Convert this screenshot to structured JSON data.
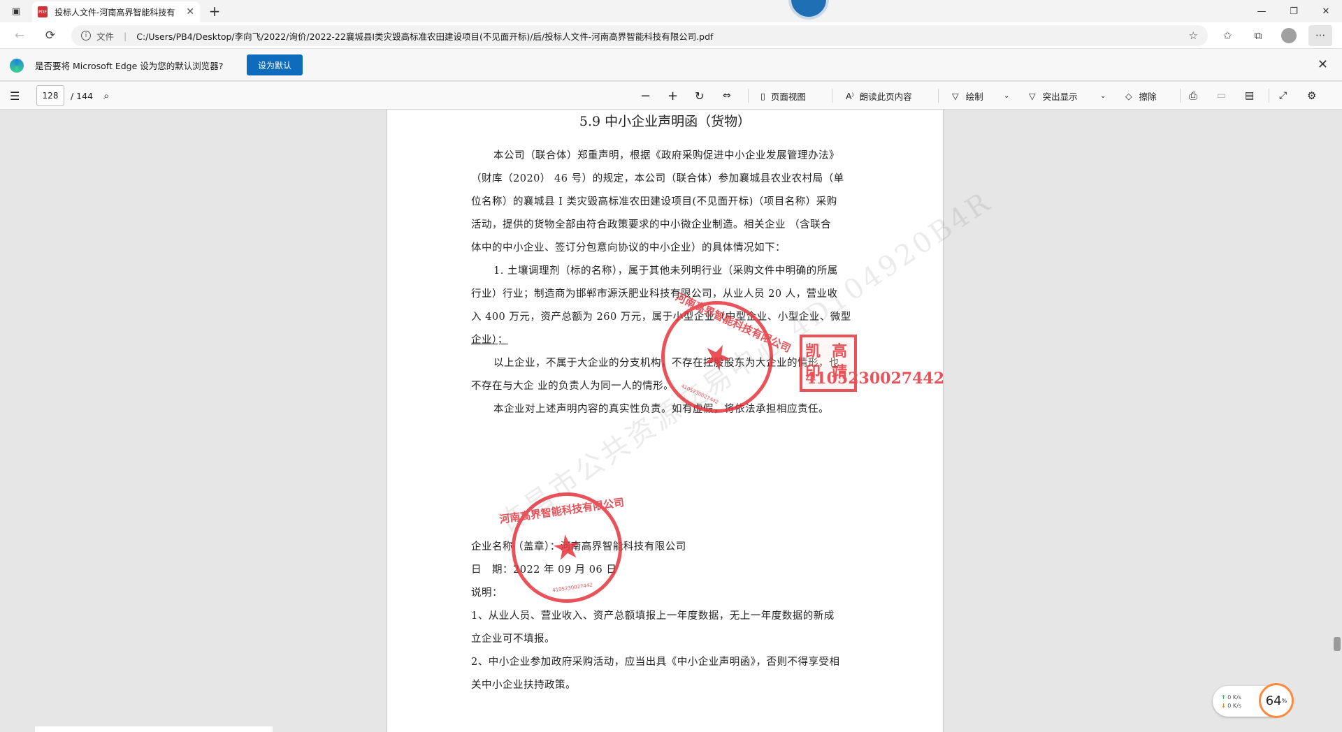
{
  "browser": {
    "tab_title": "投标人文件-河南高界智能科技有",
    "tab_icon": "pdf-icon",
    "new_tab": "+",
    "window_controls": {
      "minimize": "—",
      "restore": "❐",
      "close": "✕"
    },
    "address": {
      "label": "文件",
      "url": "C:/Users/PB4/Desktop/李向飞/2022/询价/2022-22襄城县Ⅰ类灾毁高标准农田建设项目(不见面开标)/后/投标人文件-河南高界智能科技有限公司.pdf"
    }
  },
  "infobar": {
    "message": "是否要将 Microsoft Edge 设为您的默认浏览器?",
    "button": "设为默认"
  },
  "pdf_toolbar": {
    "page_current": "128",
    "page_total": "/ 144",
    "page_view": "页面视图",
    "read_aloud": "朗读此页内容",
    "draw": "绘制",
    "highlight": "突出显示",
    "erase": "擦除"
  },
  "document": {
    "heading": "5.9 中小企业声明函（货物）",
    "lines": [
      "本公司（联合体）郑重声明，根据《政府采购促进中小企业发展管理办法》",
      "（财库（2020） 46 号）的规定，本公司（联合体）参加襄城县农业农村局（单",
      "位名称）的襄城县 I 类灾毁高标准农田建设项目(不见面开标)（项目名称）采购",
      "活动，提供的货物全部由符合政策要求的中小微企业制造。相关企业 （含联合",
      "体中的中小企业、签订分包意向协议的中小企业）的具体情况如下：",
      "1. 土壤调理剂（标的名称），属于其他未列明行业（采购文件中明确的所属",
      "行业）行业；制造商为邯郸市源沃肥业科技有限公司，从业人员 20 人，营业收",
      "入 400 万元，资产总额为 260 万元，属于小型企业（中型企业、小型企业、微型",
      "企业）；",
      "以上企业，不属于大企业的分支机构，不存在控股股东为大企业的情形，也",
      "不存在与大企 业的负责人为同一人的情形。",
      "本企业对上述声明内容的真实性负责。如有虚假，将依法承担相应责任。",
      "企业名称（盖章）：河南高界智能科技有限公司",
      "日　期：2022 年 09 月 06 日",
      "说明：",
      "1、从业人员、营业收入、资产总额填报上一年度数据，无上一年度数据的新成",
      "立企业可不填报。",
      "2、中小企业参加政府采购活动，应当出具《中小企业声明函》，否则不得享受相",
      "关中小企业扶持政策。"
    ],
    "watermark": "许昌市公共资源交易中心 4D104920B4R",
    "seal_text": "河南高界智能科技有限公司",
    "seal_number": "4105230027442",
    "personal_seal": [
      "凯",
      "高",
      "印",
      "靖"
    ]
  },
  "net_widget": {
    "up": "0 K/s",
    "down": "0 K/s",
    "gauge": "64",
    "gauge_unit": "%"
  }
}
